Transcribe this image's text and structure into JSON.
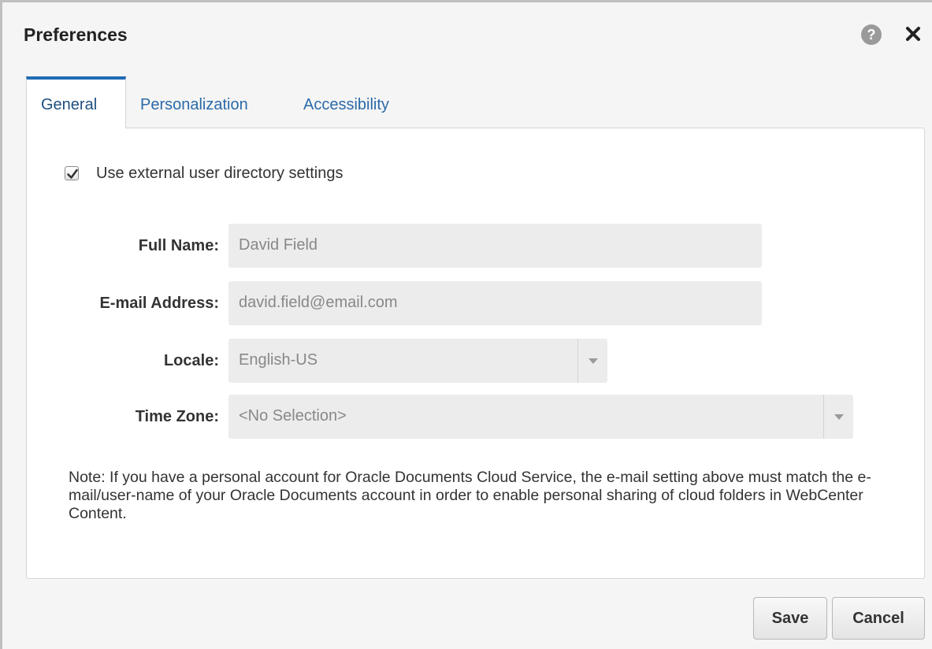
{
  "dialog": {
    "title": "Preferences",
    "help_icon": "help-circle-icon",
    "close_icon": "close-icon"
  },
  "tabs": [
    {
      "label": "General",
      "active": true
    },
    {
      "label": "Personalization",
      "active": false
    },
    {
      "label": "Accessibility",
      "active": false
    }
  ],
  "general": {
    "use_external": {
      "label": "Use external user directory settings",
      "checked": true
    },
    "fields": {
      "full_name": {
        "label": "Full Name:",
        "value": "David Field"
      },
      "email": {
        "label": "E-mail Address:",
        "value": "david.field@email.com"
      },
      "locale": {
        "label": "Locale:",
        "value": "English-US"
      },
      "time_zone": {
        "label": "Time Zone:",
        "value": "<No Selection>"
      }
    },
    "note": "Note: If you have a personal account for Oracle Documents Cloud Service, the e-mail setting above must match the e-mail/user-name of your Oracle Documents account in order to enable personal sharing of cloud folders in WebCenter Content."
  },
  "footer": {
    "save_label": "Save",
    "cancel_label": "Cancel"
  },
  "colors": {
    "tab_accent": "#1f6bb5",
    "link_blue": "#2a6aa8",
    "field_bg": "#ececec"
  }
}
